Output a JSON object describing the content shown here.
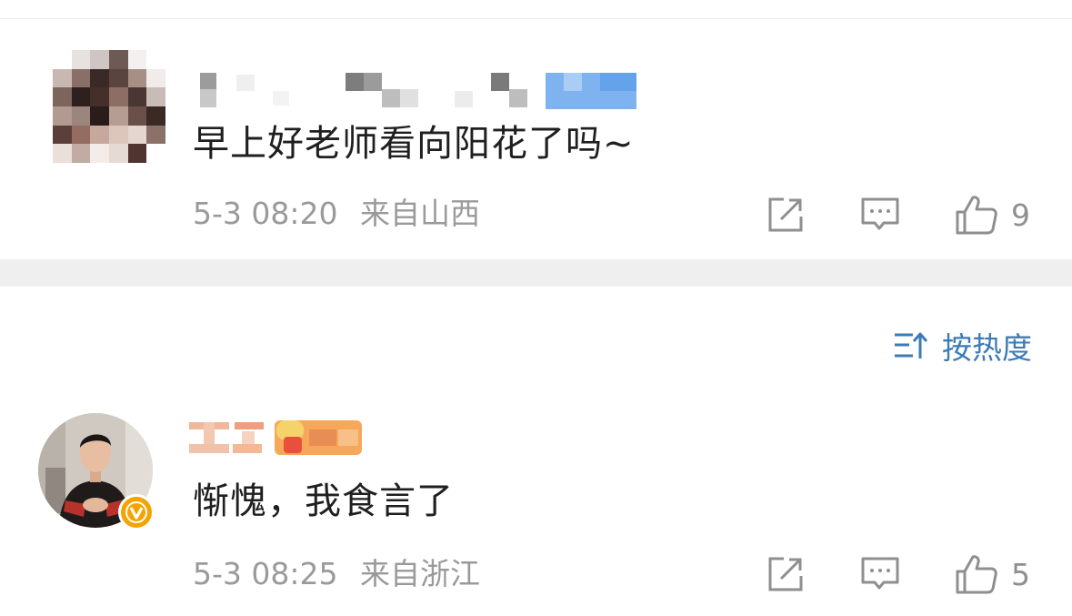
{
  "comments": [
    {
      "text": "早上好老师看向阳花了吗~",
      "time": "5-3 08:20",
      "location": "来自山西",
      "like_count": "9",
      "icons": {
        "share": "share-out-icon",
        "reply": "comment-icon",
        "like": "thumbs-up-icon"
      }
    },
    {
      "text": "惭愧，我食言了",
      "time": "5-3 08:25",
      "location": "来自浙江",
      "like_count": "5",
      "icons": {
        "share": "share-out-icon",
        "reply": "comment-icon",
        "like": "thumbs-up-icon"
      },
      "verified_badge": "V"
    }
  ],
  "sort": {
    "label": "按热度",
    "icon": "sort-by-heat-icon"
  },
  "colors": {
    "accent_blue": "#3d7bb5",
    "badge_orange": "#f5a300",
    "meta_gray": "#9a9a9a",
    "text_dark": "#1f1f1f",
    "separator": "#efefef"
  }
}
